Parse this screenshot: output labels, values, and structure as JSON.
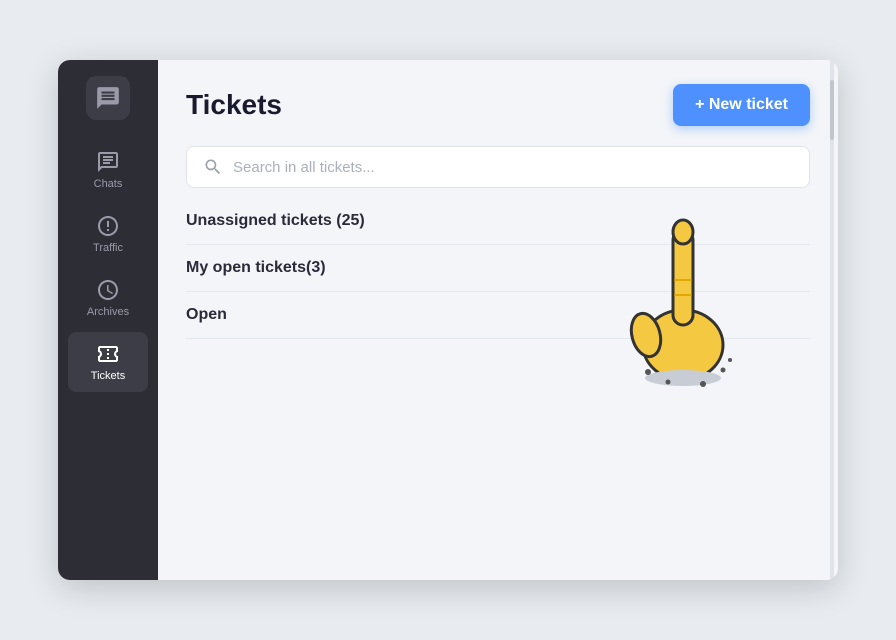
{
  "app": {
    "title": "Tickets"
  },
  "sidebar": {
    "logo_icon": "chat-logo",
    "items": [
      {
        "id": "chats",
        "label": "Chats",
        "icon": "chat-icon",
        "active": false
      },
      {
        "id": "traffic",
        "label": "Traffic",
        "icon": "traffic-icon",
        "active": false
      },
      {
        "id": "archives",
        "label": "Archives",
        "icon": "archives-icon",
        "active": false
      },
      {
        "id": "tickets",
        "label": "Tickets",
        "icon": "tickets-icon",
        "active": true
      }
    ]
  },
  "header": {
    "page_title": "Tickets",
    "new_ticket_btn": "+ New ticket"
  },
  "search": {
    "placeholder": "Search in all tickets..."
  },
  "ticket_sections": [
    {
      "label": "Unassigned tickets (25)"
    },
    {
      "label": "My open tickets(3)"
    },
    {
      "label": "Open"
    }
  ]
}
